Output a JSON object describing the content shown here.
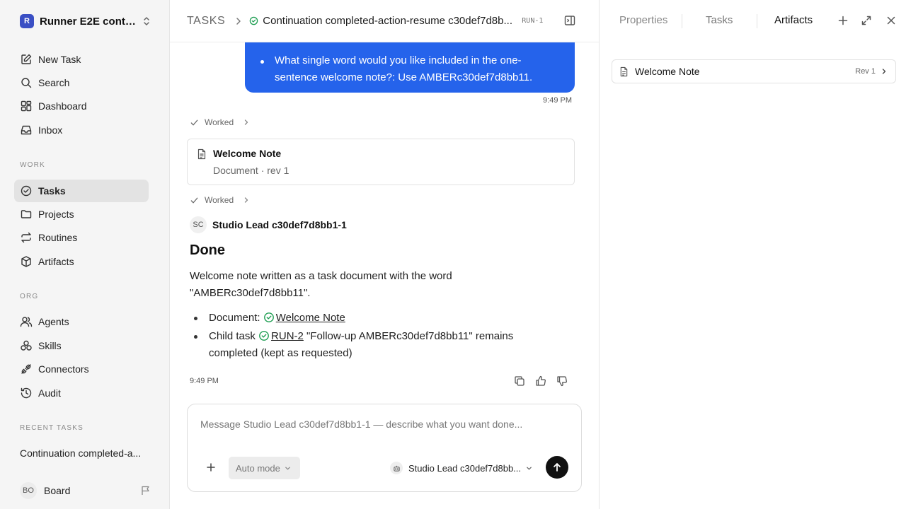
{
  "workspace": {
    "logo_letter": "R",
    "name": "Runner E2E conti..."
  },
  "nav": {
    "new_task": "New Task",
    "search": "Search",
    "dashboard": "Dashboard",
    "inbox": "Inbox",
    "work_label": "WORK",
    "tasks": "Tasks",
    "projects": "Projects",
    "routines": "Routines",
    "artifacts": "Artifacts",
    "org_label": "ORG",
    "agents": "Agents",
    "skills": "Skills",
    "connectors": "Connectors",
    "audit": "Audit",
    "recent_label": "RECENT TASKS",
    "recent_task": "Continuation completed-a..."
  },
  "user": {
    "initials": "BO",
    "name": "Board"
  },
  "header": {
    "root": "TASKS",
    "title": "Continuation completed-action-resume c30def7d8b...",
    "run_id": "RUN-1"
  },
  "thread": {
    "user_message": "What single word would you like included in the one-sentence welcome note?: Use AMBERc30def7d8bb11.",
    "user_time": "9:49 PM",
    "worked_label": "Worked",
    "doc_card": {
      "title": "Welcome Note",
      "subtitle": "Document · rev 1"
    },
    "author_initials": "SC",
    "author_name": "Studio Lead c30def7d8bb1-1",
    "heading": "Done",
    "paragraph": "Welcome note written as a task document with the word \"AMBERc30def7d8bb11\".",
    "item1_prefix": "Document:",
    "item1_link": "Welcome Note",
    "item2_prefix": "Child task",
    "item2_link": "RUN-2",
    "item2_suffix": "\"Follow-up AMBERc30def7d8bb11\" remains completed (kept as requested)",
    "agent_time": "9:49 PM"
  },
  "composer": {
    "placeholder": "Message Studio Lead c30def7d8bb1-1 — describe what you want done...",
    "mode": "Auto mode",
    "agent": "Studio Lead c30def7d8bb..."
  },
  "right_panel": {
    "tabs": [
      "Properties",
      "Tasks",
      "Artifacts"
    ],
    "active_tab": "Artifacts",
    "artifact": {
      "title": "Welcome Note",
      "rev": "Rev 1"
    }
  },
  "colors": {
    "accent": "#2563eb",
    "success": "#1e9e52",
    "send_button": "#111111"
  }
}
